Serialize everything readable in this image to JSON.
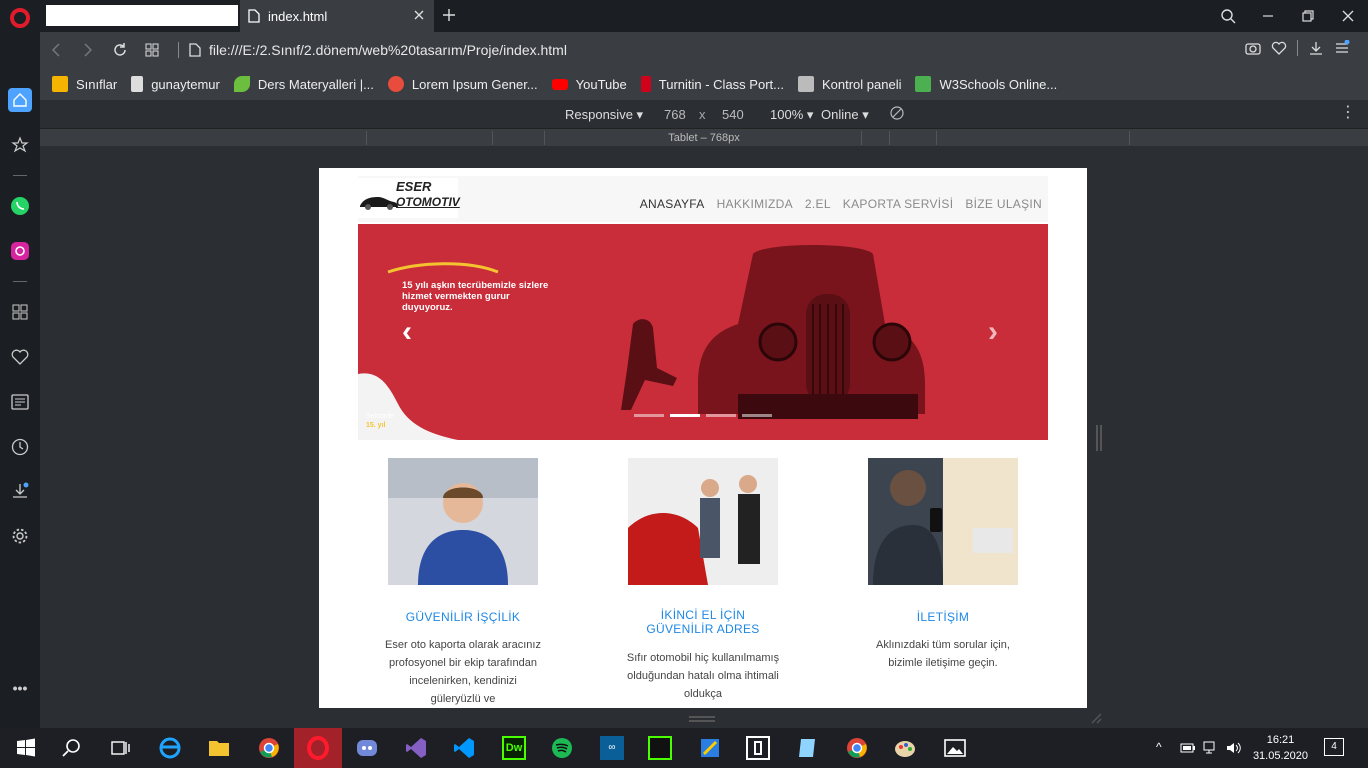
{
  "browser": {
    "tab_title": "index.html",
    "url": "file:///E:/2.Sınıf/2.dönem/web%20tasarım/Proje/index.html",
    "bookmarks": [
      {
        "label": "Sınıflar",
        "icon": "classroom-icon",
        "color": "#f4b400"
      },
      {
        "label": "gunaytemur",
        "icon": "document-icon",
        "color": "#dddddd"
      },
      {
        "label": "Ders Materyalleri |...",
        "icon": "leaf-icon",
        "color": "#6cbf3e"
      },
      {
        "label": "Lorem Ipsum Gener...",
        "icon": "lorem-icon",
        "color": "#e74c3c"
      },
      {
        "label": "YouTube",
        "icon": "youtube-icon",
        "color": "#ff0000"
      },
      {
        "label": "Turnitin - Class Port...",
        "icon": "turnitin-icon",
        "color": "#d0021b"
      },
      {
        "label": "Kontrol paneli",
        "icon": "panel-icon",
        "color": "#bbbbbb"
      },
      {
        "label": "W3Schools Online...",
        "icon": "w3schools-icon",
        "color": "#4caf50"
      }
    ]
  },
  "devtools": {
    "mode": "Responsive",
    "width": "768",
    "times": "x",
    "height": "540",
    "zoom": "100%",
    "network": "Online",
    "device_label": "Tablet – 768px"
  },
  "site": {
    "logo_line1": "ESER",
    "logo_line2": "OTOMOTIV",
    "menu": [
      "ANASAYFA",
      "HAKKIMIZDA",
      "2.EL",
      "KAPORTA SERVİSİ",
      "BİZE ULAŞIN"
    ],
    "slider": {
      "slogan": "15 yılı aşkın tecrübemizle sizlere hizmet vermekten gurur duyuyoruz.",
      "sector_label": "Sektörde",
      "sector_years": "15. yıl",
      "active_index": 1,
      "slide_count": 4
    },
    "cards": [
      {
        "title": "GÜVENİLİR İŞÇİLİK",
        "text": "Eser oto kaporta olarak aracınız profosyonel bir ekip tarafından incelenirken, kendinizi güleryüzlü ve"
      },
      {
        "title": "İKİNCİ EL İÇİN GÜVENİLİR ADRES",
        "text": "Sıfır otomobil hiç kullanılmamış olduğundan hatalı olma ihtimali oldukça"
      },
      {
        "title": "İLETİŞİM",
        "text": "Aklınızdaki tüm sorular için, bizimle iletişime geçin."
      }
    ]
  },
  "taskbar": {
    "time": "16:21",
    "date": "31.05.2020",
    "notifications": "4"
  },
  "colors": {
    "accent": "#1e88e5",
    "slider_bg": "#c92d3a",
    "opera_red": "#e01b2b"
  }
}
